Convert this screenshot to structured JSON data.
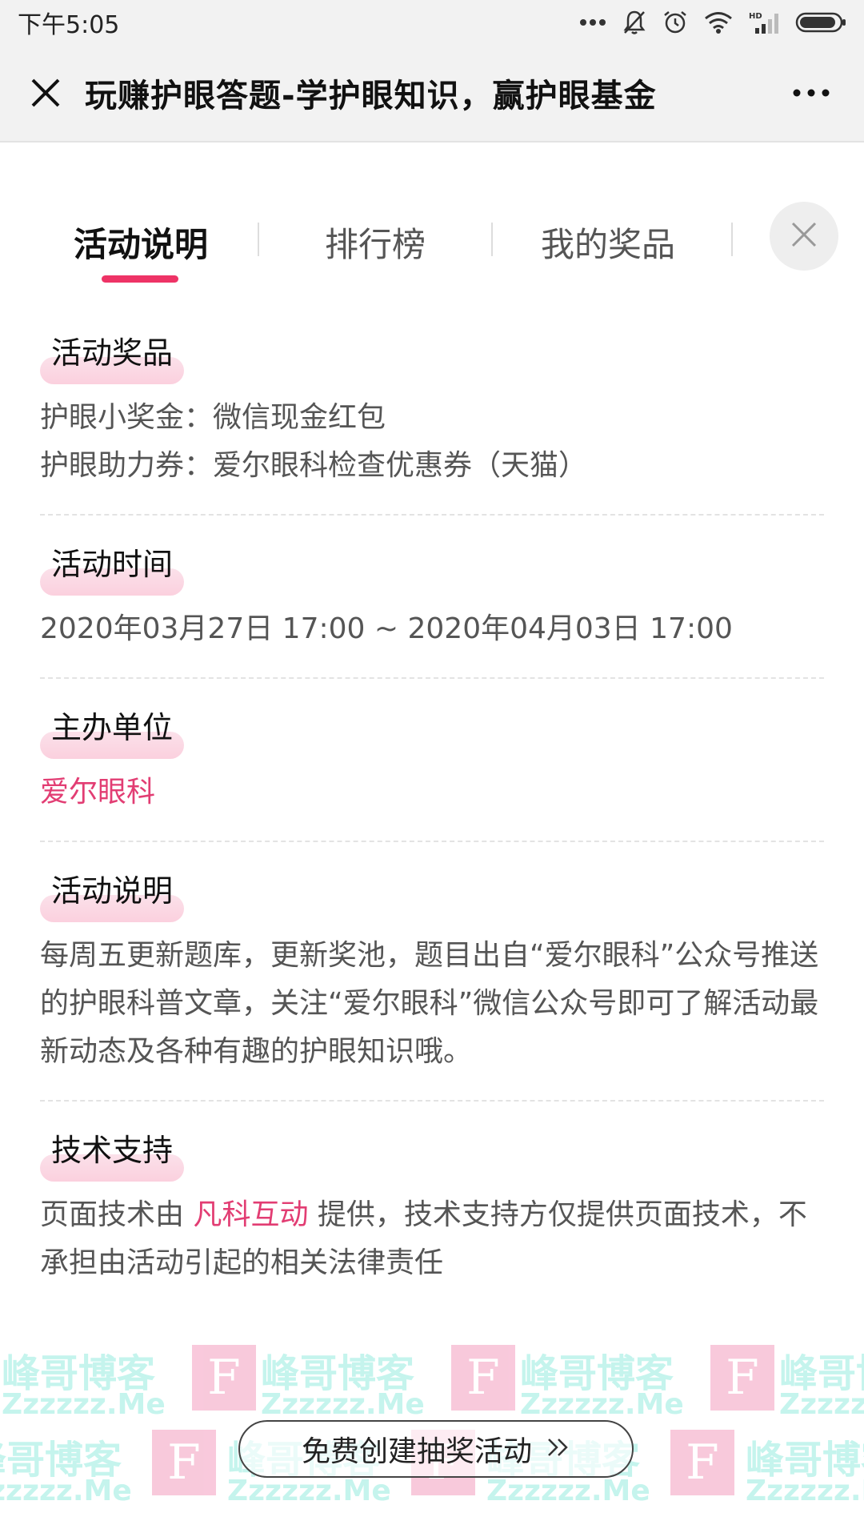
{
  "status_bar": {
    "time": "下午5:05",
    "icons": [
      "more-dots-icon",
      "mute-bell-icon",
      "alarm-icon",
      "wifi-icon",
      "signal-hd-icon",
      "battery-icon"
    ],
    "hd_label": "HD"
  },
  "nav": {
    "title": "玩赚护眼答题-学护眼知识，赢护眼基金",
    "close_icon": "close-icon",
    "more_icon": "more-icon"
  },
  "tabs": {
    "items": [
      {
        "label": "活动说明",
        "active": true
      },
      {
        "label": "排行榜",
        "active": false
      },
      {
        "label": "我的奖品",
        "active": false
      }
    ],
    "accent": "#ee3366",
    "close_icon": "close-icon"
  },
  "sections": {
    "prizes": {
      "heading": "活动奖品",
      "lines": [
        "护眼小奖金：微信现金红包",
        "护眼助力券：爱尔眼科检查优惠券（天猫）"
      ]
    },
    "time": {
      "heading": "活动时间",
      "text": "2020年03月27日 17:00 ~ 2020年04月03日 17:00"
    },
    "organizer": {
      "heading": "主办单位",
      "name": "爱尔眼科",
      "color": "#e23d73"
    },
    "description": {
      "heading": "活动说明",
      "text": "每周五更新题库，更新奖池，题目出自“爱尔眼科”公众号推送的护眼科普文章，关注“爱尔眼科”微信公众号即可了解活动最新动态及各种有趣的护眼知识哦。"
    },
    "tech": {
      "heading": "技术支持",
      "before": "页面技术由 ",
      "link": "凡科互动",
      "after": " 提供，技术支持方仅提供页面技术，不承担由活动引起的相关法律责任"
    }
  },
  "bottom_button": {
    "label": "免费创建抽奖活动",
    "icon": "double-chevron-right-icon"
  },
  "watermark": {
    "name": "峰哥博客",
    "domain": "Zzzzzz.Me",
    "logo_letter": "F",
    "color": "#7fe8d9"
  }
}
